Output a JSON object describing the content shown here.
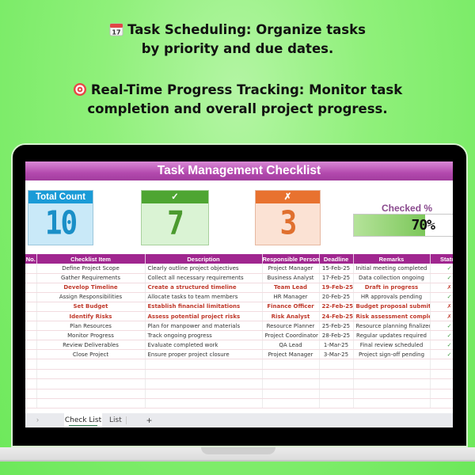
{
  "headline": {
    "line1a": "Task Scheduling: Organize tasks",
    "line1b": "by priority and due dates.",
    "line2a": "Real-Time Progress Tracking: Monitor task",
    "line2b": "completion and overall project progress.",
    "icon1": "calendar-icon",
    "icon2": "target-icon"
  },
  "sheet": {
    "title": "Task Management Checklist",
    "kpis": {
      "total_label": "Total Count",
      "total_value": "10",
      "checked_label": "✓",
      "checked_value": "7",
      "unchecked_label": "✗",
      "unchecked_value": "3",
      "checked_pct_label": "Checked %",
      "checked_pct_text": "70%",
      "checked_pct_fraction": 0.7
    },
    "columns": [
      "No.",
      "Checklist Item",
      "Description",
      "Responsible Person",
      "Deadline",
      "Remarks",
      "Status"
    ],
    "rows": [
      {
        "item": "Define Project Scope",
        "desc": "Clearly outline project objectives",
        "person": "Project Manager",
        "deadline": "15-Feb-25",
        "remarks": "Initial meeting completed",
        "status": "✓"
      },
      {
        "item": "Gather Requirements",
        "desc": "Collect all necessary requirements",
        "person": "Business Analyst",
        "deadline": "17-Feb-25",
        "remarks": "Data collection ongoing",
        "status": "✓"
      },
      {
        "item": "Develop Timeline",
        "desc": "Create a structured timeline",
        "person": "Team Lead",
        "deadline": "19-Feb-25",
        "remarks": "Draft in progress",
        "status": "✗"
      },
      {
        "item": "Assign Responsibilities",
        "desc": "Allocate tasks to team members",
        "person": "HR Manager",
        "deadline": "20-Feb-25",
        "remarks": "HR approvals pending",
        "status": "✓"
      },
      {
        "item": "Set Budget",
        "desc": "Establish financial limitations",
        "person": "Finance Officer",
        "deadline": "22-Feb-25",
        "remarks": "Budget proposal submitted",
        "status": "✗"
      },
      {
        "item": "Identify Risks",
        "desc": "Assess potential project risks",
        "person": "Risk Analyst",
        "deadline": "24-Feb-25",
        "remarks": "Risk assessment completed",
        "status": "✗"
      },
      {
        "item": "Plan Resources",
        "desc": "Plan for manpower and materials",
        "person": "Resource Planner",
        "deadline": "25-Feb-25",
        "remarks": "Resource planning finalized",
        "status": "✓"
      },
      {
        "item": "Monitor Progress",
        "desc": "Track ongoing progress",
        "person": "Project Coordinator",
        "deadline": "28-Feb-25",
        "remarks": "Regular updates required",
        "status": "✓"
      },
      {
        "item": "Review Deliverables",
        "desc": "Evaluate completed work",
        "person": "QA Lead",
        "deadline": "1-Mar-25",
        "remarks": "Final review scheduled",
        "status": "✓"
      },
      {
        "item": "Close Project",
        "desc": "Ensure proper project closure",
        "person": "Project Manager",
        "deadline": "3-Mar-25",
        "remarks": "Project sign-off pending",
        "status": "✓"
      }
    ],
    "empty_rows": 5,
    "tabs": {
      "nav": "›",
      "active": "Check List",
      "second": "List",
      "add": "+"
    }
  }
}
